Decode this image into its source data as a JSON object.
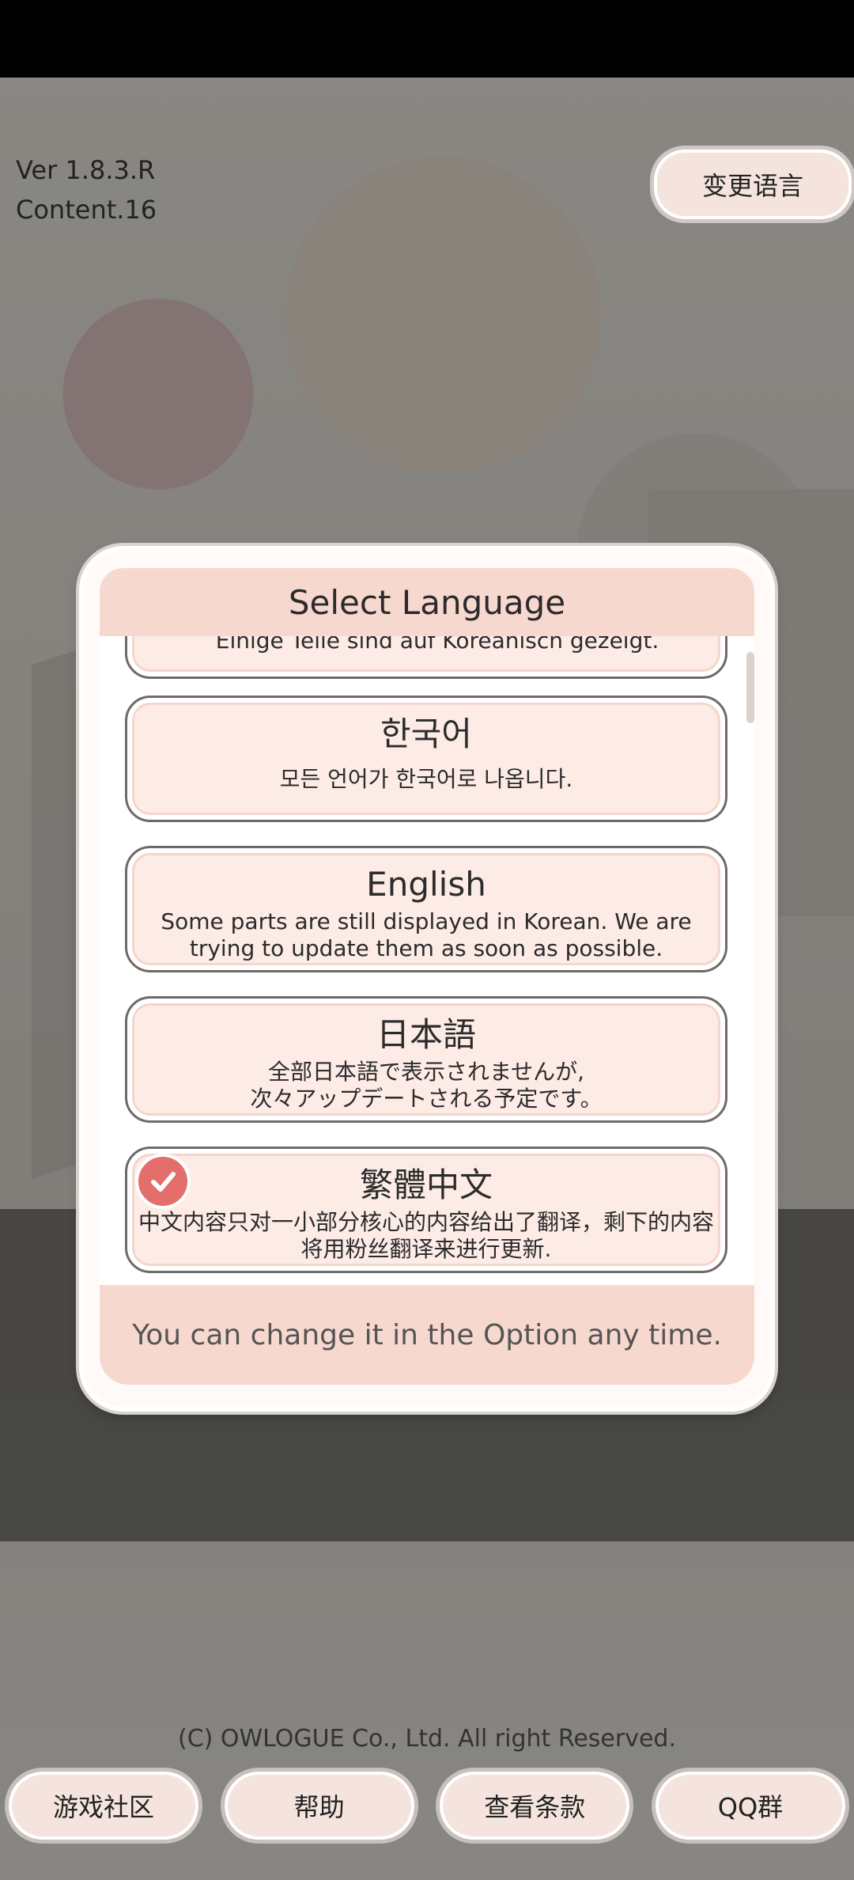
{
  "header": {
    "version": "Ver 1.8.3.R",
    "content": "Content.16",
    "change_language_button": "变更语言"
  },
  "dialog": {
    "title": "Select Language",
    "languages": [
      {
        "title": "",
        "subtitle": "Einige Teile sind auf Koreanisch gezeigt.",
        "selected": false
      },
      {
        "title": "한국어",
        "subtitle": "모든 언어가 한국어로 나옵니다.",
        "selected": false
      },
      {
        "title": "English",
        "subtitle": "Some parts are still displayed in Korean. We are trying to update them as soon as possible.",
        "selected": false
      },
      {
        "title": "日本語",
        "subtitle": "全部日本語で表示されませんが,\n次々アップデートされる予定です。",
        "selected": false
      },
      {
        "title": "繁體中文",
        "subtitle": "中文内容只对一小部分核心的内容给出了翻译，剩下的内容将用粉丝翻译来进行更新.",
        "selected": true
      }
    ],
    "footer_note": "You can change it in the Option any time."
  },
  "footer": {
    "copyright": "(C) OWLOGUE Co., Ltd. All right Reserved.",
    "buttons": [
      "游戏社区",
      "帮助",
      "查看条款",
      "QQ群"
    ]
  },
  "colors": {
    "accent": "#e46e6c",
    "panel": "#f7d8cf",
    "item_bg": "#fdebe6"
  }
}
